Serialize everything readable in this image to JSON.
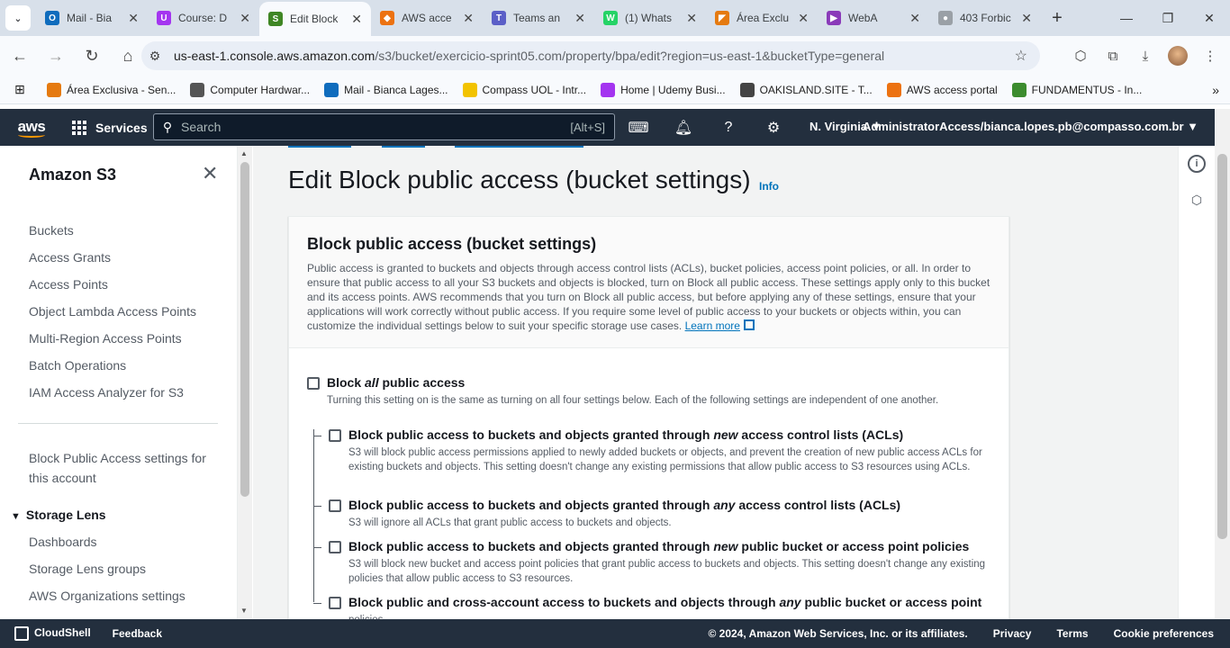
{
  "browser": {
    "tabs": [
      {
        "title": "Mail - Bia",
        "color": "#0f6cbd",
        "glyph": "O"
      },
      {
        "title": "Course: D",
        "color": "#a435f0",
        "glyph": "U"
      },
      {
        "title": "Edit Block",
        "color": "#3f8624",
        "glyph": "S",
        "active": true
      },
      {
        "title": "AWS acce",
        "color": "#ec7211",
        "glyph": "◆"
      },
      {
        "title": "Teams an",
        "color": "#5b5fc7",
        "glyph": "T"
      },
      {
        "title": "(1) Whats",
        "color": "#25d366",
        "glyph": "W"
      },
      {
        "title": "Área Exclu",
        "color": "#e57a10",
        "glyph": "◤"
      },
      {
        "title": "WebA",
        "color": "#8a3ab9",
        "glyph": "▶"
      },
      {
        "title": "403 Forbic",
        "color": "#9aa0a6",
        "glyph": "●"
      }
    ],
    "url_host": "us-east-1.console.aws.amazon.com",
    "url_path": "/s3/bucket/exercicio-sprint05.com/property/bpa/edit?region=us-east-1&bucketType=general",
    "bookmarks": [
      {
        "label": "Área Exclusiva - Sen...",
        "color": "#e57a10"
      },
      {
        "label": "Computer Hardwar...",
        "color": "#555555"
      },
      {
        "label": "Mail - Bianca Lages...",
        "color": "#0f6cbd"
      },
      {
        "label": "Compass UOL - Intr...",
        "color": "#f2c300"
      },
      {
        "label": "Home | Udemy Busi...",
        "color": "#a435f0"
      },
      {
        "label": "OAKISLAND.SITE - T...",
        "color": "#444444"
      },
      {
        "label": "AWS access portal",
        "color": "#ec7211"
      },
      {
        "label": "FUNDAMENTUS - In...",
        "color": "#3c8c2e"
      }
    ]
  },
  "aws": {
    "logo": "aws",
    "services_label": "Services",
    "search_placeholder": "Search",
    "search_shortcut": "[Alt+S]",
    "region": "N. Virginia ▼",
    "account": "AdministratorAccess/bianca.lopes.pb@compasso.com.br ▼"
  },
  "sidebar": {
    "title": "Amazon S3",
    "items": [
      "Buckets",
      "Access Grants",
      "Access Points",
      "Object Lambda Access Points",
      "Multi-Region Access Points",
      "Batch Operations",
      "IAM Access Analyzer for S3"
    ],
    "bpa_line1": "Block Public Access settings for",
    "bpa_line2": "this account",
    "storage_lens": "Storage Lens",
    "lens_items": [
      "Dashboards",
      "Storage Lens groups",
      "AWS Organizations settings"
    ]
  },
  "main": {
    "title": "Edit Block public access (bucket settings)",
    "info": "Info",
    "panel_title": "Block public access (bucket settings)",
    "panel_desc": "Public access is granted to buckets and objects through access control lists (ACLs), bucket policies, access point policies, or all. In order to ensure that public access to all your S3 buckets and objects is blocked, turn on Block all public access. These settings apply only to this bucket and its access points. AWS recommends that you turn on Block all public access, but before applying any of these settings, ensure that your applications will work correctly without public access. If you require some level of public access to your buckets or objects within, you can customize the individual settings below to suit your specific storage use cases.",
    "learn_more": "Learn more",
    "block_all": {
      "pre": "Block ",
      "em": "all",
      "post": " public access",
      "desc": "Turning this setting on is the same as turning on all four settings below. Each of the following settings are independent of one another."
    },
    "options": [
      {
        "pre": "Block public access to buckets and objects granted through ",
        "em": "new",
        "post": " access control lists (ACLs)",
        "desc": "S3 will block public access permissions applied to newly added buckets or objects, and prevent the creation of new public access ACLs for existing buckets and objects. This setting doesn't change any existing permissions that allow public access to S3 resources using ACLs."
      },
      {
        "pre": "Block public access to buckets and objects granted through ",
        "em": "any",
        "post": " access control lists (ACLs)",
        "desc": "S3 will ignore all ACLs that grant public access to buckets and objects."
      },
      {
        "pre": "Block public access to buckets and objects granted through ",
        "em": "new",
        "post": " public bucket or access point policies",
        "desc": "S3 will block new bucket and access point policies that grant public access to buckets and objects. This setting doesn't change any existing policies that allow public access to S3 resources."
      },
      {
        "pre": "Block public and cross-account access to buckets and objects through ",
        "em": "any",
        "post": " public bucket or access point",
        "desc": "policies"
      }
    ]
  },
  "footer": {
    "cloudshell": "CloudShell",
    "feedback": "Feedback",
    "copyright": "© 2024, Amazon Web Services, Inc. or its affiliates.",
    "privacy": "Privacy",
    "terms": "Terms",
    "cookies": "Cookie preferences"
  }
}
